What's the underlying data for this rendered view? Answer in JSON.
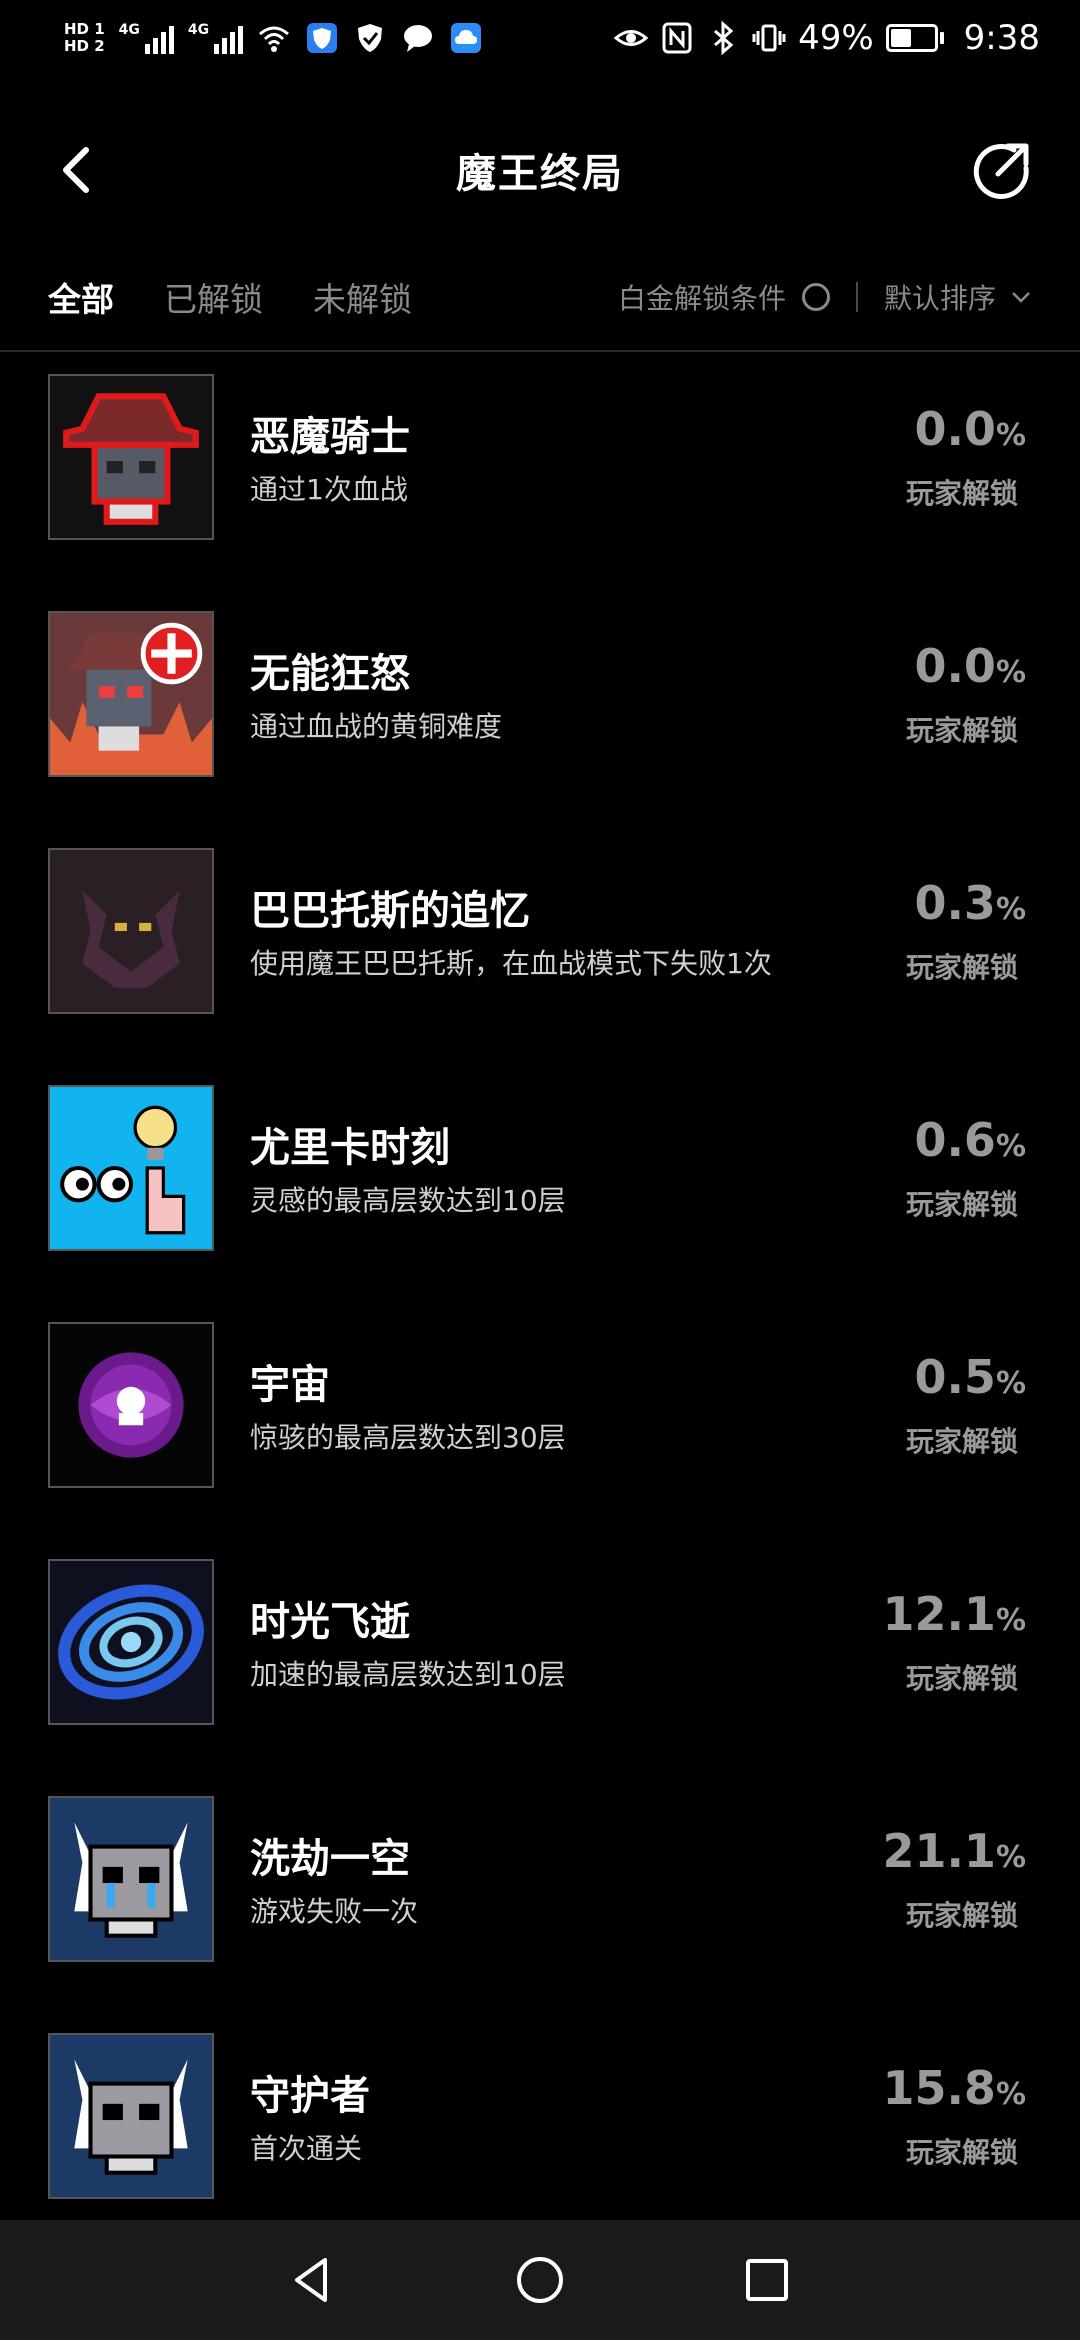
{
  "status_bar": {
    "hd1": "HD 1",
    "hd2": "HD 2",
    "net1": "4G",
    "net2": "4G",
    "battery_pct": "49%",
    "battery_level": 0.49,
    "time": "9:38",
    "icons": [
      "wifi-icon",
      "shield-icon",
      "check-shield-icon",
      "message-icon",
      "cloud-icon",
      "eye-icon",
      "nfc-icon",
      "bluetooth-icon",
      "vibrate-icon"
    ]
  },
  "header": {
    "title": "魔王终局",
    "back_icon": "chevron-left-icon",
    "share_icon": "share-icon"
  },
  "tabs": {
    "items": [
      "全部",
      "已解锁",
      "未解锁"
    ],
    "active": "全部",
    "filter_label": "白金解锁条件",
    "sort_label": "默认排序"
  },
  "achievements": [
    {
      "title": "恶魔骑士",
      "desc": "通过1次血战",
      "pct": "0.0",
      "unit": "%",
      "label": "玩家解锁",
      "bg": "#111111"
    },
    {
      "title": "无能狂怒",
      "desc": "通过血战的黄铜难度",
      "pct": "0.0",
      "unit": "%",
      "label": "玩家解锁",
      "bg": "#6a3a3a"
    },
    {
      "title": "巴巴托斯的追忆",
      "desc": "使用魔王巴巴托斯，在血战模式下失败1次",
      "pct": "0.3",
      "unit": "%",
      "label": "玩家解锁",
      "bg": "#2a1f24"
    },
    {
      "title": "尤里卡时刻",
      "desc": "灵感的最高层数达到10层",
      "pct": "0.6",
      "unit": "%",
      "label": "玩家解锁",
      "bg": "#12b4f0"
    },
    {
      "title": "宇宙",
      "desc": "惊骇的最高层数达到30层",
      "pct": "0.5",
      "unit": "%",
      "label": "玩家解锁",
      "bg": "#050505"
    },
    {
      "title": "时光飞逝",
      "desc": "加速的最高层数达到10层",
      "pct": "12.1",
      "unit": "%",
      "label": "玩家解锁",
      "bg": "#0e1020"
    },
    {
      "title": "洗劫一空",
      "desc": "游戏失败一次",
      "pct": "21.1",
      "unit": "%",
      "label": "玩家解锁",
      "bg": "#1d3a66"
    },
    {
      "title": "守护者",
      "desc": "首次通关",
      "pct": "15.8",
      "unit": "%",
      "label": "玩家解锁",
      "bg": "#1d3a66"
    }
  ],
  "navbar": {
    "icons": [
      "nav-back-icon",
      "nav-home-icon",
      "nav-recents-icon"
    ]
  }
}
